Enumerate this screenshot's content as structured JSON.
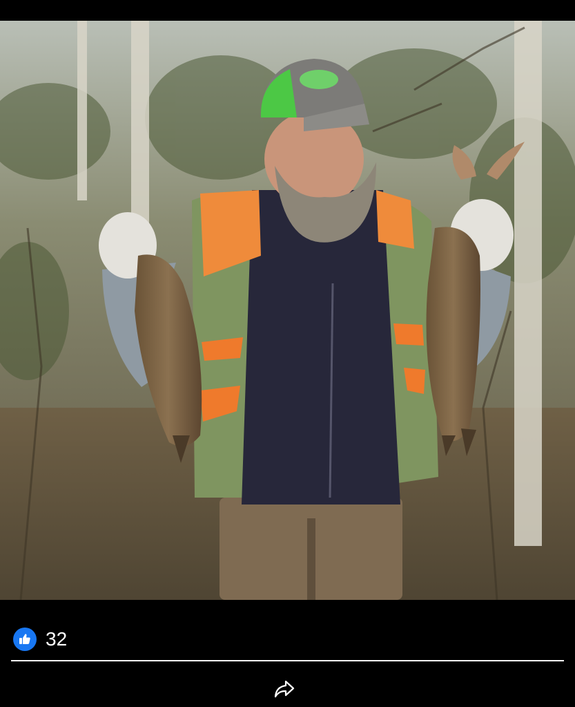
{
  "photo": {
    "caption_icon": "image"
  },
  "reactions": {
    "icon": "thumbs-up-icon",
    "count": "32",
    "accent_color": "#1877f2"
  },
  "actions": {
    "share_icon": "share-arrow-icon"
  }
}
